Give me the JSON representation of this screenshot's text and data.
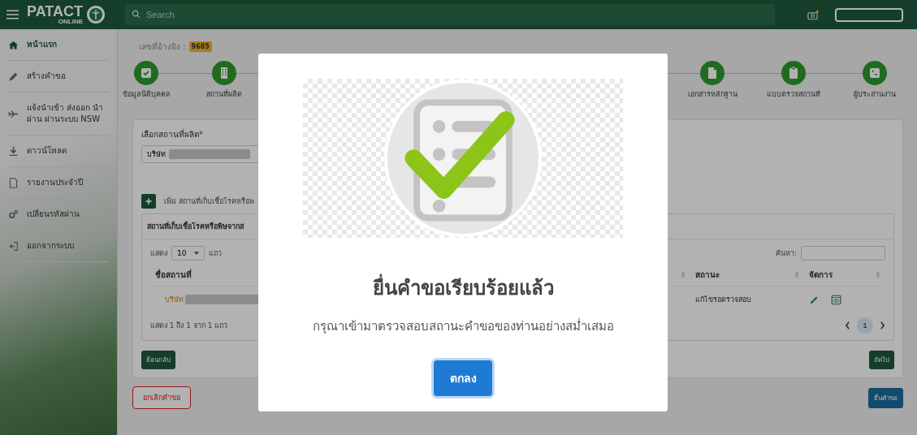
{
  "topbar": {
    "logo": {
      "title": "PATACT",
      "subtitle": "ONLINE"
    },
    "search": {
      "placeholder": "Search"
    }
  },
  "sidebar": {
    "items": [
      {
        "label": "หน้าแรก",
        "kind": "home"
      },
      {
        "label": "สร้างคำขอ",
        "kind": "pencil"
      },
      {
        "label": "แจ้งนำเข้า ส่งออก นำผ่าน ผ่านระบบ NSW",
        "kind": "plane"
      },
      {
        "label": "ดาวน์โหลด",
        "kind": "download"
      },
      {
        "label": "รายงานประจำปี",
        "kind": "file"
      },
      {
        "label": "เปลี่ยนรหัสผ่าน",
        "kind": "gears"
      },
      {
        "label": "ออกจากระบบ",
        "kind": "logout"
      }
    ]
  },
  "reference": {
    "label": "เลขที่อ้างอิง :",
    "badge": "9685"
  },
  "steps_left": [
    {
      "label": "ข้อมูลนิติบุคคล",
      "kind": "check"
    },
    {
      "label": "สถานที่ผลิต",
      "kind": "building"
    }
  ],
  "steps_right": [
    {
      "label": "เอกสารหลักฐาน",
      "kind": "file"
    },
    {
      "label": "แบบตรวจสถานที่",
      "kind": "clipboard"
    },
    {
      "label": "ผู้ประสานงาน",
      "kind": "phone"
    }
  ],
  "form": {
    "label": "เลือกสถานที่ผลิต",
    "required_mark": "*",
    "select_value": "บริษัท",
    "add_button": "+",
    "add_label": "เพิ่ม สถานที่เก็บเชื้อโรคหรือพ"
  },
  "table": {
    "title": "สถานที่เก็บเชื้อโรคหรือพิษจากส",
    "length_before": "แสดง",
    "length_value": "10",
    "length_after": "แถว",
    "search_label": "ค้นหา:",
    "columns": [
      {
        "label": "ชื่อสถานที่",
        "sortable": true
      },
      {
        "label": "สถานะ",
        "sortable": true
      },
      {
        "label": "จัดการ",
        "sortable": true
      }
    ],
    "rows": [
      {
        "name": "บริษัท",
        "status": "แก้ไขรอตรวจสอบ"
      }
    ],
    "info": "แสดง 1 ถึง 1 จาก 1 แถว",
    "pages": [
      {
        "label": "1",
        "selected": true
      }
    ]
  },
  "buttons": {
    "back": "ย้อนกลับ",
    "next": "ถัดไป",
    "cancel": "ยกเลิกคำขอ",
    "submit": "ยื่นคำขอ"
  },
  "modal": {
    "title": "ยื่นคำขอเรียบร้อยแล้ว",
    "message": "กรุณาเข้ามาตรวจสอบสถานะคำขอของท่านอย่างสม่ำเสมอ",
    "button": "ตกลง"
  }
}
